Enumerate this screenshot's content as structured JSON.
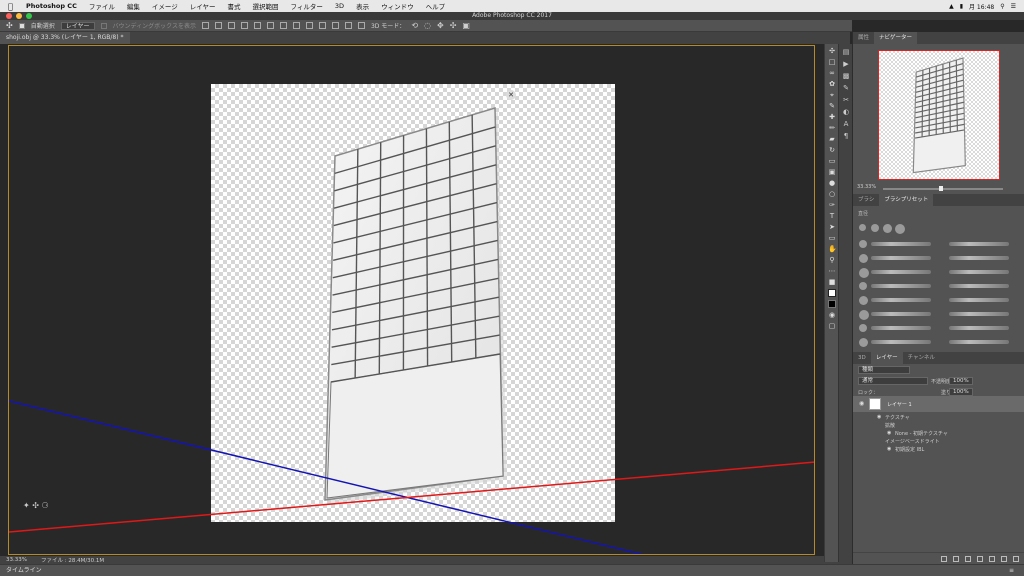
{
  "menubar": {
    "app": "Photoshop CC",
    "items": [
      "ファイル",
      "編集",
      "イメージ",
      "レイヤー",
      "書式",
      "選択範囲",
      "フィルター",
      "3D",
      "表示",
      "ウィンドウ",
      "ヘルプ"
    ],
    "clock": "月 16:48"
  },
  "window": {
    "title": "Adobe Photoshop CC 2017"
  },
  "options": {
    "auto_select_label": "自動選択",
    "auto_select_target": "レイヤー",
    "bounding_label": "バウンディングボックスを表示",
    "mode_3d": "3D モード："
  },
  "document": {
    "tab_label": "shoji.obj @ 33.3% (レイヤー 1, RGB/8) *"
  },
  "status": {
    "zoom": "33.33%",
    "file": "ファイル : 28.4M/30.1M"
  },
  "timeline": {
    "label": "タイムライン"
  },
  "navigator": {
    "tabs": [
      "属性",
      "ナビゲーター"
    ],
    "active": 1,
    "zoom": "33.33%"
  },
  "brushes": {
    "tabs": [
      "ブラシ",
      "ブラシプリセット"
    ],
    "active": 1,
    "size_label": "直径"
  },
  "layers": {
    "tabs": [
      "3D",
      "レイヤー",
      "チャンネル"
    ],
    "active": 1,
    "filter": "種類",
    "blend": "通常",
    "opacity_label": "不透明度:",
    "opacity": "100%",
    "lock_label": "ロック：",
    "fill_label": "塗り:",
    "fill": "100%",
    "layer_name": "レイヤー 1",
    "texture_label": "テクスチャ",
    "diffuse_label": "拡散",
    "texture_name": "None - 初期テクスチャ",
    "ibl_label": "イメージベースドライト",
    "ibl_name": "初期設定 IBL"
  },
  "colors": {
    "accent_frame": "#b58a2a",
    "axis_red": "#e01818",
    "axis_blue": "#1414b4"
  }
}
